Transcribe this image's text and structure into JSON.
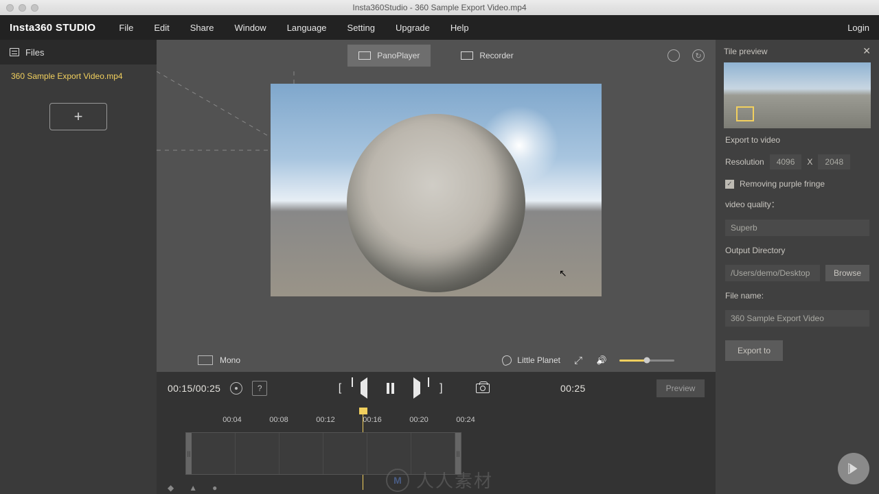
{
  "window": {
    "title": "Insta360Studio - 360 Sample Export Video.mp4"
  },
  "menubar": {
    "brand": "Insta360 STUDIO",
    "items": [
      "File",
      "Edit",
      "Share",
      "Window",
      "Language",
      "Setting",
      "Upgrade",
      "Help"
    ],
    "login": "Login"
  },
  "sidebar": {
    "header": "Files",
    "items": [
      "360 Sample Export Video.mp4"
    ]
  },
  "topTabs": {
    "pano": "PanoPlayer",
    "recorder": "Recorder"
  },
  "modebar": {
    "mono": "Mono",
    "projection": "Little Planet"
  },
  "transport": {
    "timeCurrent": "00:15/00:25",
    "help": "?",
    "timeOut": "00:25",
    "previewBtn": "Preview"
  },
  "timeline": {
    "ticks": [
      "00:04",
      "00:08",
      "00:12",
      "00:16",
      "00:20",
      "00:24"
    ]
  },
  "panel": {
    "title": "Tile preview",
    "exportTo": "Export to video",
    "resLabel": "Resolution",
    "resW": "4096",
    "resX": "X",
    "resH": "2048",
    "fringe": "Removing purple fringe",
    "qualityLabel": "video quality：",
    "qualityValue": "Superb",
    "outDirLabel": "Output Directory",
    "outDir": "/Users/demo/Desktop",
    "browse": "Browse",
    "fileNameLabel": "File name:",
    "fileName": "360 Sample Export Video",
    "exportBtn": "Export to"
  },
  "watermark": "人人素材"
}
